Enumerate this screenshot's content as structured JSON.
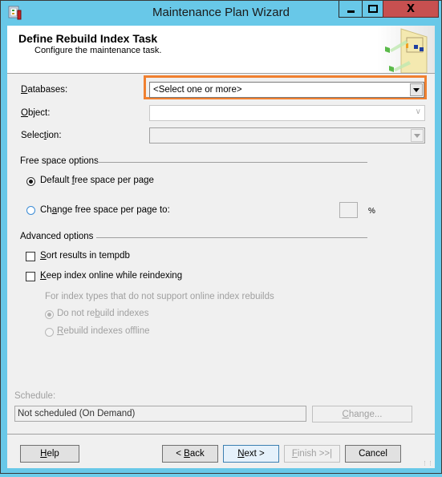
{
  "window": {
    "title": "Maintenance Plan Wizard",
    "controls": [
      "minimize",
      "maximize",
      "close"
    ],
    "close_glyph": "X"
  },
  "header": {
    "title": "Define Rebuild Index Task",
    "subtitle": "Configure the maintenance task."
  },
  "fields": {
    "databases": {
      "label_accel": "D",
      "label_rest": "atabases:",
      "value": "<Select one or more>",
      "highlighted": true,
      "highlight_color": "#f08030"
    },
    "object": {
      "label_accel": "O",
      "label_rest": "bject:",
      "value": "",
      "enabled": false
    },
    "selection": {
      "label_pre": "Selec",
      "label_accel": "t",
      "label_rest": "ion:",
      "value": "",
      "enabled": false
    }
  },
  "free_space": {
    "group_label": "Free space options",
    "options": [
      {
        "pre": "Default ",
        "accel": "f",
        "rest": "ree space per page",
        "selected": true
      },
      {
        "pre": "Ch",
        "accel": "a",
        "rest": "nge free space per page to:",
        "selected": false
      }
    ],
    "percent_value": "",
    "percent_unit": "%"
  },
  "advanced": {
    "group_label": "Advanced options",
    "checkboxes": [
      {
        "accel": "S",
        "rest": "ort results in tempdb",
        "checked": false
      },
      {
        "accel": "K",
        "rest": "eep index online while reindexing",
        "checked": false
      }
    ],
    "sub_label": "For index types that do not support online index rebuilds",
    "sub_options": [
      {
        "pre": "Do not re",
        "accel": "b",
        "rest": "uild indexes",
        "selected": true,
        "enabled": false
      },
      {
        "pre": "",
        "accel": "R",
        "rest": "ebuild indexes offline",
        "selected": false,
        "enabled": false
      }
    ]
  },
  "schedule": {
    "label": "Schedule:",
    "value": "Not scheduled (On Demand)",
    "change_accel": "C",
    "change_rest": "hange..."
  },
  "buttons": {
    "help": {
      "accel": "H",
      "rest": "elp"
    },
    "back": {
      "pre": "< ",
      "accel": "B",
      "rest": "ack"
    },
    "next": {
      "accel": "N",
      "rest": "ext >"
    },
    "finish": {
      "accel": "F",
      "rest": "inish >>|"
    },
    "cancel": {
      "label": "Cancel"
    }
  }
}
